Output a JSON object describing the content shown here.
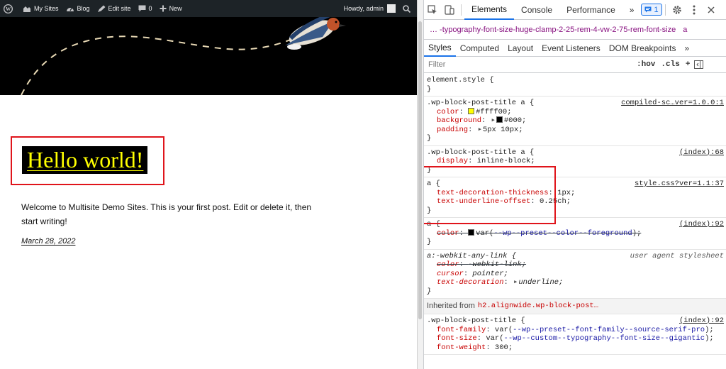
{
  "admin_bar": {
    "my_sites": "My Sites",
    "blog": "Blog",
    "edit_site": "Edit site",
    "comments_count": "0",
    "new": "New",
    "howdy": "Howdy, admin"
  },
  "post": {
    "title": "Hello world!",
    "excerpt": "Welcome to Multisite Demo Sites. This is your first post. Edit or delete it, then start writing!",
    "date": "March 28, 2022"
  },
  "devtools": {
    "tabs": [
      "Elements",
      "Console",
      "Performance"
    ],
    "more_tabs": "»",
    "issues_count": "1",
    "breadcrumb": "…  -typography-font-size-huge-clamp-2-25-rem-4-vw-2-75-rem-font-size",
    "breadcrumb_tag": "a",
    "subtabs": [
      "Styles",
      "Computed",
      "Layout",
      "Event Listeners",
      "DOM Breakpoints"
    ],
    "subtabs_more": "»",
    "filter_placeholder": "Filter",
    "hov": ":hov",
    "cls": ".cls",
    "plus": "+",
    "rules": {
      "element_style": "element.style {",
      "close": "}",
      "r1": {
        "selector": ".wp-block-post-title a {",
        "source": "compiled-sc…ver=1.0.0:1",
        "color_prop": "color",
        "color_val": "#ffff00;",
        "color_swatch": "#ffff00",
        "bg_prop": "background",
        "bg_val": "#000;",
        "bg_swatch": "#000000",
        "pad_prop": "padding",
        "pad_val": "5px 10px;"
      },
      "r2": {
        "selector": ".wp-block-post-title a {",
        "source": "(index):68",
        "display_prop": "display",
        "display_val": "inline-block;"
      },
      "r3": {
        "selector": "a {",
        "source": "style.css?ver=1.1:37",
        "tdt_prop": "text-decoration-thickness",
        "tdt_val": "1px;",
        "tuo_prop": "text-underline-offset",
        "tuo_val": "0.25ch;"
      },
      "r4": {
        "selector": "a {",
        "source": "(index):92",
        "color_prop": "color",
        "color_var_open": "var(",
        "color_var_name": "--wp--preset--color--foreground",
        "color_var_close": ");",
        "color_swatch": "#000000"
      },
      "r5": {
        "selector": "a:-webkit-any-link {",
        "source": "user agent stylesheet",
        "color_prop": "color",
        "color_val": "-webkit-link;",
        "cursor_prop": "cursor",
        "cursor_val": "pointer;",
        "td_prop": "text-decoration",
        "td_val": "underline;"
      },
      "inherited_label": "Inherited from",
      "inherited_selector": "h2.alignwide.wp-block-post…",
      "r6": {
        "selector": ".wp-block-post-title {",
        "source": "(index):92",
        "ff_prop": "font-family",
        "ff_open": "var(",
        "ff_var": "--wp--preset--font-family--source-serif-pro",
        "ff_close": ");",
        "fs_prop": "font-size",
        "fs_open": "var(",
        "fs_var": "--wp--custom--typography--font-size--gigantic",
        "fs_close": ");",
        "fw_prop": "font-weight",
        "fw_val": "300;"
      }
    }
  }
}
